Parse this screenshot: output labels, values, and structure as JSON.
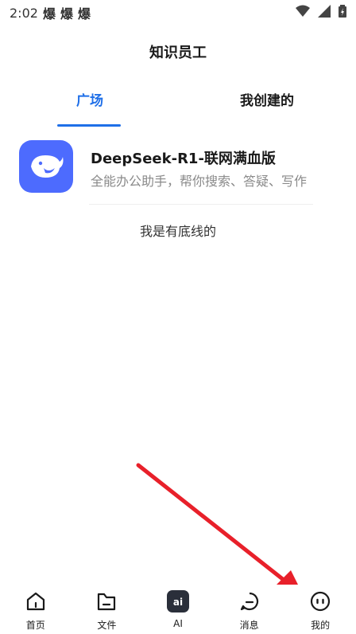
{
  "status_bar": {
    "time": "2:02",
    "notifications": [
      "爆",
      "爆",
      "爆"
    ]
  },
  "header": {
    "title": "知识员工"
  },
  "tabs": [
    {
      "label": "广场",
      "active": true
    },
    {
      "label": "我创建的",
      "active": false
    }
  ],
  "assistant": {
    "name": "DeepSeek-R1-联网满血版",
    "description": "全能办公助手，帮你搜索、答疑、写作",
    "avatar_icon": "deepseek-whale-icon"
  },
  "end_note": "我是有底线的",
  "bottom_nav": [
    {
      "label": "首页",
      "icon": "home-icon"
    },
    {
      "label": "文件",
      "icon": "folder-icon"
    },
    {
      "label": "AI",
      "icon": "ai-icon"
    },
    {
      "label": "消息",
      "icon": "message-icon"
    },
    {
      "label": "我的",
      "icon": "profile-icon"
    }
  ],
  "colors": {
    "accent": "#1f6fe8",
    "avatar_bg": "#4d6bfe",
    "annotation_arrow": "#e8202a"
  }
}
